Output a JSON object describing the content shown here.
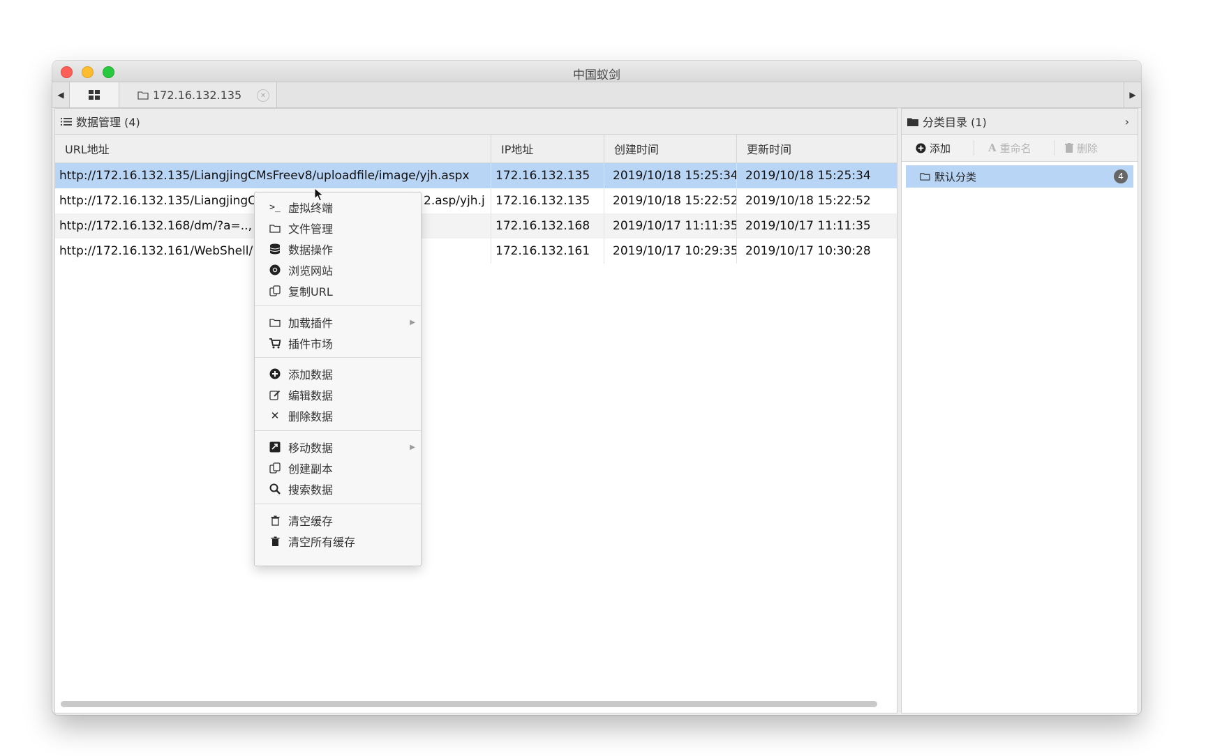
{
  "window": {
    "title": "中国蚁剑"
  },
  "tabs": {
    "host_label": "172.16.132.135"
  },
  "data_panel": {
    "title": "数据管理 (4)",
    "columns": [
      "URL地址",
      "IP地址",
      "创建时间",
      "更新时间"
    ],
    "rows": [
      {
        "url": "http://172.16.132.135/LiangjingCMsFreev8/uploadfile/image/yjh.aspx",
        "ip": "172.16.132.135",
        "created": "2019/10/18 15:25:34",
        "updated": "2019/10/18 15:25:34"
      },
      {
        "url": "http://172.16.132.135/LiangjingC",
        "url_tail": "2.asp/yjh.j",
        "ip": "172.16.132.135",
        "created": "2019/10/18 15:22:52",
        "updated": "2019/10/18 15:22:52"
      },
      {
        "url": "http://172.16.132.168/dm/?a=..,",
        "ip": "172.16.132.168",
        "created": "2019/10/17 11:11:35",
        "updated": "2019/10/17 11:11:35"
      },
      {
        "url": "http://172.16.132.161/WebShell/",
        "ip": "172.16.132.161",
        "created": "2019/10/17 10:29:35",
        "updated": "2019/10/17 10:30:28"
      }
    ]
  },
  "category_panel": {
    "title": "分类目录 (1)",
    "toolbar": {
      "add": "添加",
      "rename": "重命名",
      "delete": "删除"
    },
    "items": [
      {
        "label": "默认分类",
        "count": "4"
      }
    ]
  },
  "context_menu": {
    "items": [
      {
        "label": "虚拟终端",
        "icon": "terminal-icon"
      },
      {
        "label": "文件管理",
        "icon": "folder-icon"
      },
      {
        "label": "数据操作",
        "icon": "database-icon"
      },
      {
        "label": "浏览网站",
        "icon": "chrome-icon"
      },
      {
        "label": "复制URL",
        "icon": "copy-icon"
      },
      {
        "label": "加载插件",
        "icon": "folder-icon"
      },
      {
        "label": "插件市场",
        "icon": "cart-icon"
      },
      {
        "label": "添加数据",
        "icon": "plus-circle-icon"
      },
      {
        "label": "编辑数据",
        "icon": "edit-icon"
      },
      {
        "label": "删除数据",
        "icon": "close-icon"
      },
      {
        "label": "移动数据",
        "icon": "move-icon"
      },
      {
        "label": "创建副本",
        "icon": "copy-icon"
      },
      {
        "label": "搜索数据",
        "icon": "search-icon"
      },
      {
        "label": "清空缓存",
        "icon": "trash-outline-icon"
      },
      {
        "label": "清空所有缓存",
        "icon": "trash-icon"
      }
    ]
  },
  "colors": {
    "selection": "#b9d5f6",
    "close": "#fe5f57",
    "minimize": "#febc2e",
    "maximize": "#28c840"
  }
}
